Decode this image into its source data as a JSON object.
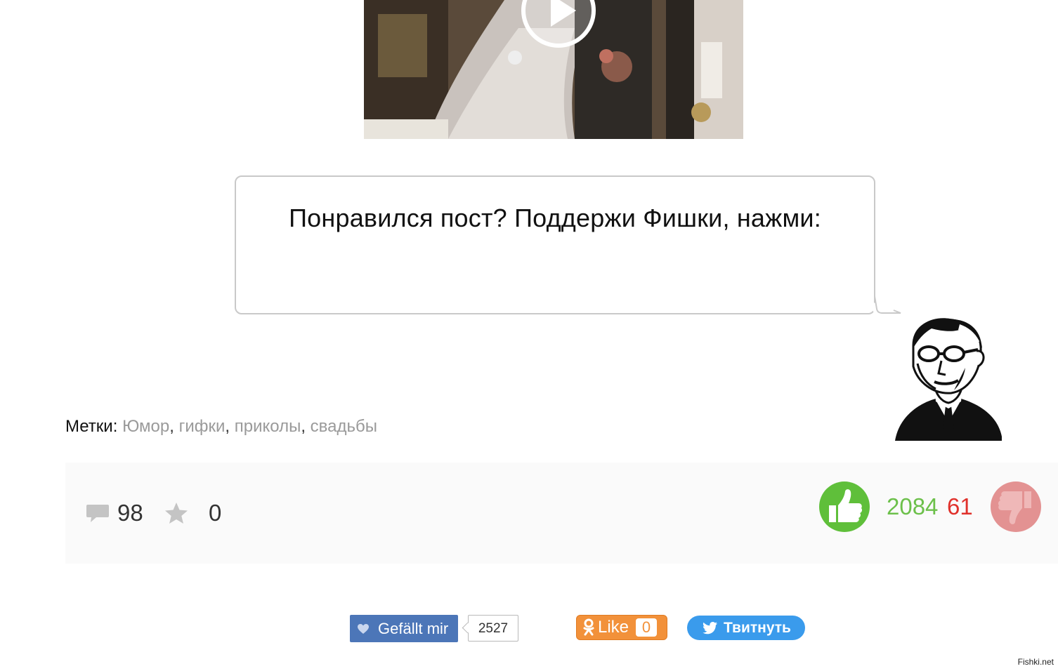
{
  "bubble": {
    "text": "Понравился пост? Поддержи Фишки, нажми:"
  },
  "tags": {
    "label": "Метки:",
    "items": [
      "Юмор",
      "гифки",
      "приколы",
      "свадьбы"
    ]
  },
  "stats": {
    "comments": "98",
    "favorites": "0",
    "score_up": "2084",
    "score_down": "61"
  },
  "share": {
    "facebook_label": "Gefällt mir",
    "facebook_count": "2527",
    "ok_label": "Like",
    "ok_count": "0",
    "twitter_label": "Твитнуть"
  },
  "watermark": "Fishki.net",
  "icons": {
    "play": "play-icon",
    "comment": "comment-bubble-icon",
    "favorite": "star-icon",
    "like": "thumbs-up-icon",
    "dislike": "thumbs-down-icon",
    "facebook": "heart-icon",
    "ok": "odnoklassniki-icon",
    "twitter": "twitter-bird-icon"
  },
  "colors": {
    "vote_up": "#5fbf3a",
    "vote_down": "#e39292",
    "score_up": "#6cc04a",
    "score_down": "#e0312b",
    "facebook": "#4c76b8",
    "ok": "#f2913a",
    "twitter": "#3a9bec",
    "tag_link": "#9a9a9a"
  }
}
